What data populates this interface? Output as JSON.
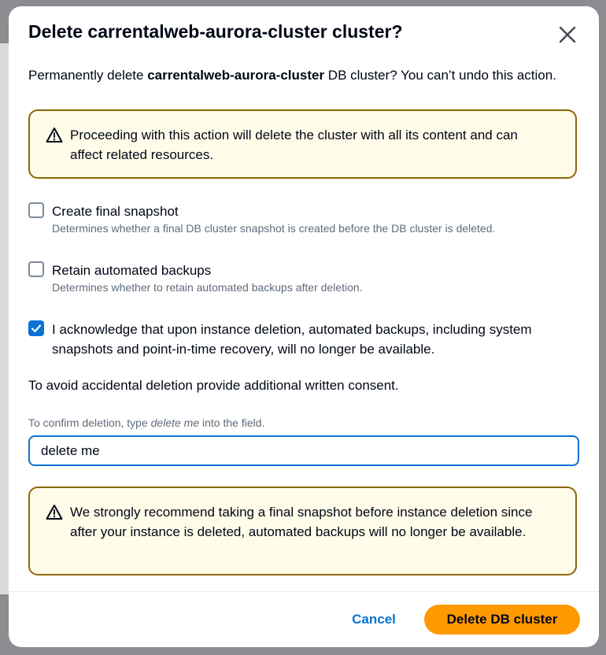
{
  "dialog": {
    "title": "Delete carrentalweb-aurora-cluster cluster?",
    "intro_prefix": "Permanently delete ",
    "intro_cluster": "carrentalweb-aurora-cluster",
    "intro_suffix": " DB cluster? You can’t undo this action."
  },
  "alerts": [
    {
      "icon": "warning-icon",
      "text": "Proceeding with this action will delete the cluster with all its content and can affect related resources."
    },
    {
      "icon": "warning-icon",
      "text": "We strongly recommend taking a final snapshot before instance deletion since after your instance is deleted, automated backups will no longer be available."
    }
  ],
  "options": [
    {
      "label": "Create final snapshot",
      "description": "Determines whether a final DB cluster snapshot is created before the DB cluster is deleted.",
      "checked": false
    },
    {
      "label": "Retain automated backups",
      "description": "Determines whether to retain automated backups after deletion.",
      "checked": false
    },
    {
      "label": "I acknowledge that upon instance deletion, automated backups, including system snapshots and point-in-time recovery, will no longer be available.",
      "checked": true
    }
  ],
  "consent": {
    "text": "To avoid accidental deletion provide additional written consent.",
    "field_label_prefix": "To confirm deletion, type ",
    "field_label_phrase": "delete me",
    "field_label_suffix": " into the field.",
    "input_value": "delete me"
  },
  "footer": {
    "cancel_label": "Cancel",
    "delete_label": "Delete DB cluster"
  },
  "colors": {
    "primary": "#0972d3",
    "warning_border": "#8d6605",
    "warning_bg": "#fffce9",
    "delete_button": "#ff9900"
  }
}
